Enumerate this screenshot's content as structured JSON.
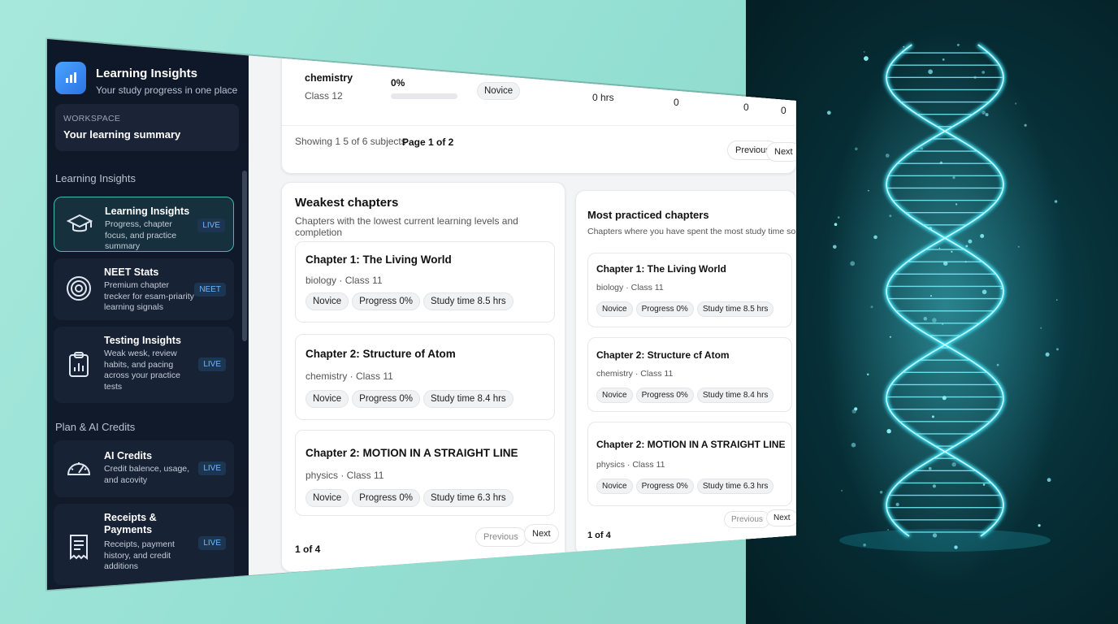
{
  "sidebar": {
    "app_title": "Learning Insights",
    "app_subtitle": "Your study progress in one place",
    "workspace_label": "WORKSPACE",
    "workspace_title": "Your learning summary",
    "section_learning": "Learning Insights",
    "section_plan": "Plan & AI Credits",
    "items": [
      {
        "title": "Learning Insights",
        "desc": "Progress, chapter focus, and practice summary",
        "badge": "LIVE"
      },
      {
        "title": "NEET Stats",
        "desc": "Premium chapter trecker for esam-priarity learning signals",
        "badge": "NEET"
      },
      {
        "title": "Testing Insights",
        "desc": "Weak wesk, review habits, and pacing across your practice tests",
        "badge": "LIVE"
      },
      {
        "title": "AI Credits",
        "desc": "Credit balence, usage, and acovity",
        "badge": "LIVE"
      },
      {
        "title": "Receipts & Payments",
        "desc": "Receipts, payment history, and credit additions",
        "badge": "LIVE"
      }
    ]
  },
  "subjects": {
    "row": {
      "subject": "chemistry",
      "class": "Class 12",
      "progress": "0%",
      "progress_value": 0,
      "level": "Novice",
      "hours": "0 hrs",
      "c1": "0",
      "c2": "0",
      "c3": "0"
    },
    "showing": "Showing 1 5 of 6 subjects",
    "page": "Page 1 of 2",
    "prev": "Previous",
    "next": "Next"
  },
  "weakest": {
    "title": "Weakest chapters",
    "subtitle": "Chapters with the lowest current learning levels and completion",
    "chapters": [
      {
        "name": "Chapter 1: The Living World",
        "meta": "biology · Class 11",
        "level": "Novice",
        "progress": "Progress 0%",
        "time": "Study time 8.5 hrs"
      },
      {
        "name": "Chapter 2: Structure of Atom",
        "meta": "chemistry · Class 11",
        "level": "Novice",
        "progress": "Progress 0%",
        "time": "Study time 8.4 hrs"
      },
      {
        "name": "Chapter 2: MOTION IN A STRAIGHT LINE",
        "meta": "physics · Class 11",
        "level": "Novice",
        "progress": "Progress 0%",
        "time": "Study time 6.3 hrs"
      }
    ],
    "pager": "1 of 4",
    "prev": "Previous",
    "next": "Next"
  },
  "practiced": {
    "title": "Most practiced chapters",
    "subtitle": "Chapters where you have spent the most study time so far.",
    "chapters": [
      {
        "name": "Chapter 1: The Living World",
        "meta": "biology · Class 11",
        "level": "Novice",
        "progress": "Progress 0%",
        "time": "Study time 8.5 hrs"
      },
      {
        "name": "Chapter 2: Structure cf Atom",
        "meta": "chemistry · Class 11",
        "level": "Novice",
        "progress": "Progress 0%",
        "time": "Study time 8.4 hrs"
      },
      {
        "name": "Chapter 2: MOTION IN A STRAIGHT LINE",
        "meta": "physics · Class 11",
        "level": "Novice",
        "progress": "Progress 0%",
        "time": "Study time 6.3 hrs"
      }
    ],
    "pager": "1 of 4",
    "prev": "Previous",
    "next": "Next"
  },
  "colors": {
    "accent": "#3fb9b8",
    "sidebar_bg": "#0f1828",
    "badge_text": "#6fb6ff",
    "dna_glow": "#2ee6ff"
  },
  "icons": [
    "bar-chart-icon",
    "graduation-cap-icon",
    "target-icon",
    "clipboard-chart-icon",
    "speedometer-icon",
    "receipt-icon",
    "dna-helix-icon"
  ]
}
